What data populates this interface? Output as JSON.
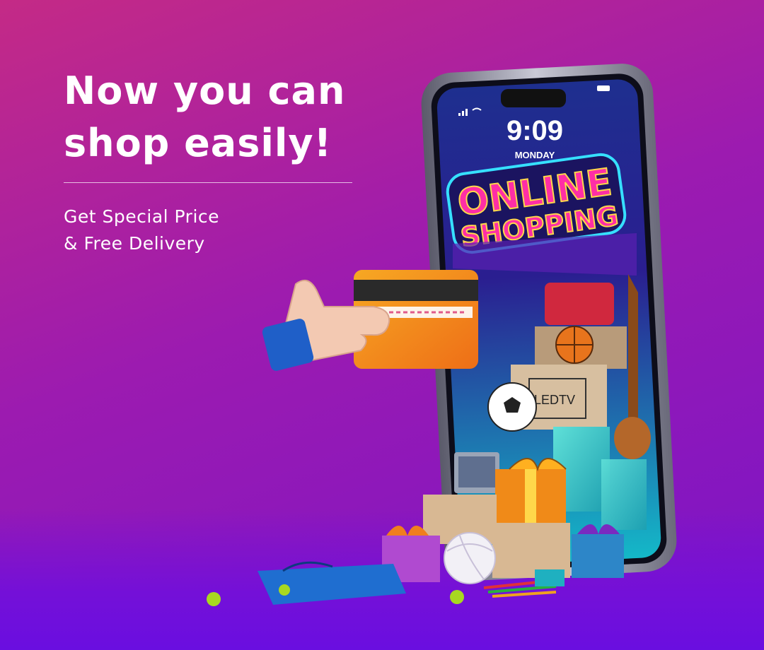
{
  "headline": {
    "line1": "Now you can",
    "line2": "shop easily!"
  },
  "subtext": {
    "line1": "Get Special Price",
    "line2": "& Free Delivery"
  },
  "phone": {
    "time": "9:09",
    "day": "MONDAY",
    "sign_line1": "ONLINE",
    "sign_line2": "SHOPPING",
    "tv_label": "LEDTV"
  },
  "colors": {
    "bg_top": "#c42a86",
    "bg_bottom": "#7a14c8",
    "sign_pink": "#ff2ea6",
    "sign_yellow": "#ffd84a",
    "sign_cyan": "#36e0ff"
  }
}
